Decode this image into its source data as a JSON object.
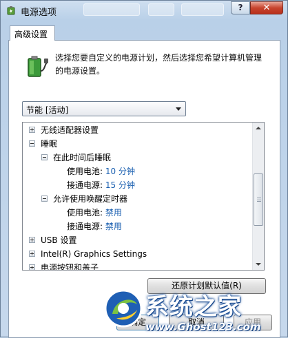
{
  "window": {
    "title": "电源选项",
    "help_label": "?",
    "close_label": "✕"
  },
  "tab": {
    "label": "高级设置"
  },
  "intro_text": "选择您要自定义的电源计划，然后选择您希望计算机管理的电源设置。",
  "plan_select": {
    "value": "节能 [活动]"
  },
  "tree": {
    "items": [
      {
        "label": "无线适配器设置",
        "toggle": "plus",
        "level": 0
      },
      {
        "label": "睡眠",
        "toggle": "minus",
        "level": 0
      },
      {
        "label": "在此时间后睡眠",
        "toggle": "minus",
        "level": 1
      },
      {
        "label": "使用电池:",
        "value": "10 分钟",
        "toggle": "none",
        "level": 2
      },
      {
        "label": "接通电源:",
        "value": "15 分钟",
        "toggle": "none",
        "level": 2
      },
      {
        "label": "允许使用唤醒定时器",
        "toggle": "minus",
        "level": 1
      },
      {
        "label": "使用电池:",
        "value": "禁用",
        "toggle": "none",
        "level": 2
      },
      {
        "label": "接通电源:",
        "value": "禁用",
        "toggle": "none",
        "level": 2
      },
      {
        "label": "USB 设置",
        "toggle": "plus",
        "level": 0
      },
      {
        "label": "Intel(R) Graphics Settings",
        "toggle": "plus",
        "level": 0
      },
      {
        "label": "电源按钮和盖子",
        "toggle": "plus",
        "level": 0
      }
    ]
  },
  "buttons": {
    "restore": "还原计划默认值(R)",
    "ok": "确定",
    "cancel": "取消",
    "apply": "应用"
  },
  "watermark": {
    "name": "系统之家",
    "url": "www.Ghost123.com"
  },
  "colors": {
    "value_link": "#1a5fb0",
    "close_button": "#c8442e"
  }
}
